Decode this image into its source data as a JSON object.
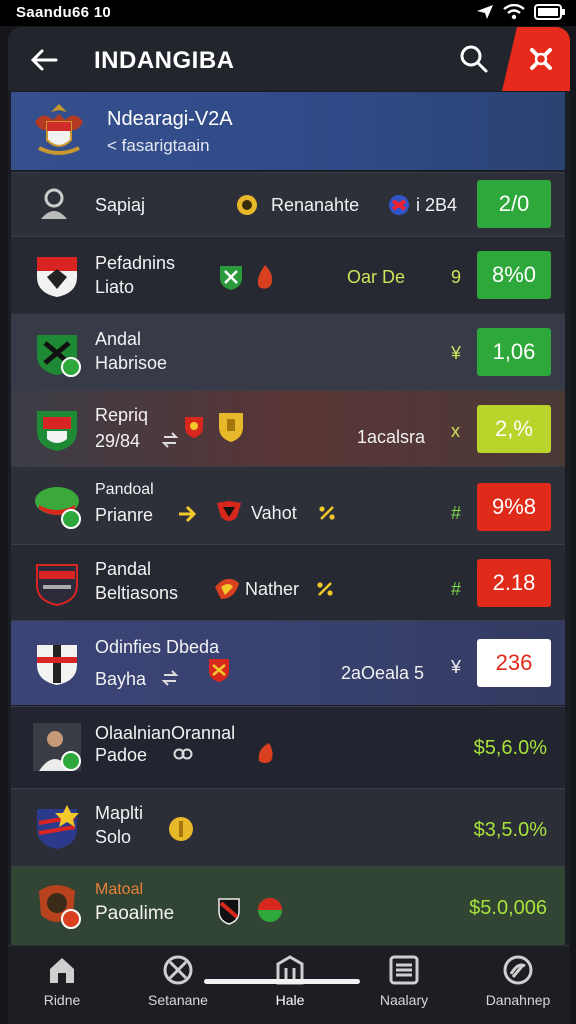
{
  "status_bar": {
    "time": "Saandu66 10"
  },
  "header": {
    "title": "INDANGIBA"
  },
  "league": {
    "title": "Ndearagi-V2A",
    "subtitle": "< fasarigtaain"
  },
  "rows": [
    {
      "line1": "Sapiaj",
      "mid": "Renanahte",
      "extra": "i 2B4",
      "odds": "2/0"
    },
    {
      "line1": "Pefadnins",
      "line2": "Liato",
      "mid": "Oar De",
      "extra": "9",
      "odds": "8%0"
    },
    {
      "line1": "Andal",
      "line2": "Habrisoe",
      "extra": "¥",
      "odds": "1,06"
    },
    {
      "line1": "Repriq",
      "line2": "29/84",
      "mid": "1acalsra",
      "extra": "x",
      "odds": "2,%"
    },
    {
      "line1": "Pandoal",
      "line2": "Prianre",
      "mid": "Vahot",
      "extra": "#",
      "odds": "9%8"
    },
    {
      "line1": "Pandal",
      "line2": "Beltiasons",
      "mid": "Nather",
      "extra": "#",
      "odds": "2.18"
    },
    {
      "line1": "Odinfies Dbeda",
      "line2": "Bayha",
      "mid": "2aOeala 5",
      "extra": "¥",
      "odds": "236"
    },
    {
      "line1": "OlaalnianOrannal",
      "line2": "Padoe",
      "pct": "$5,6.0%"
    },
    {
      "line1": "Maplti",
      "line2": "Solo",
      "pct": "$3,5.0%"
    },
    {
      "line1": "Matoal",
      "line2": "Paoalime",
      "pct": "$5.0,006"
    }
  ],
  "nav": {
    "home": "Ridne",
    "sports": "Setanane",
    "hale": "Hale",
    "history": "Naalary",
    "profile": "Danahnep"
  },
  "colors": {
    "green": "#2ea83a",
    "red": "#e02a1a",
    "lime": "#b9d42a",
    "header": "#23252d",
    "banner": "#35508d"
  }
}
